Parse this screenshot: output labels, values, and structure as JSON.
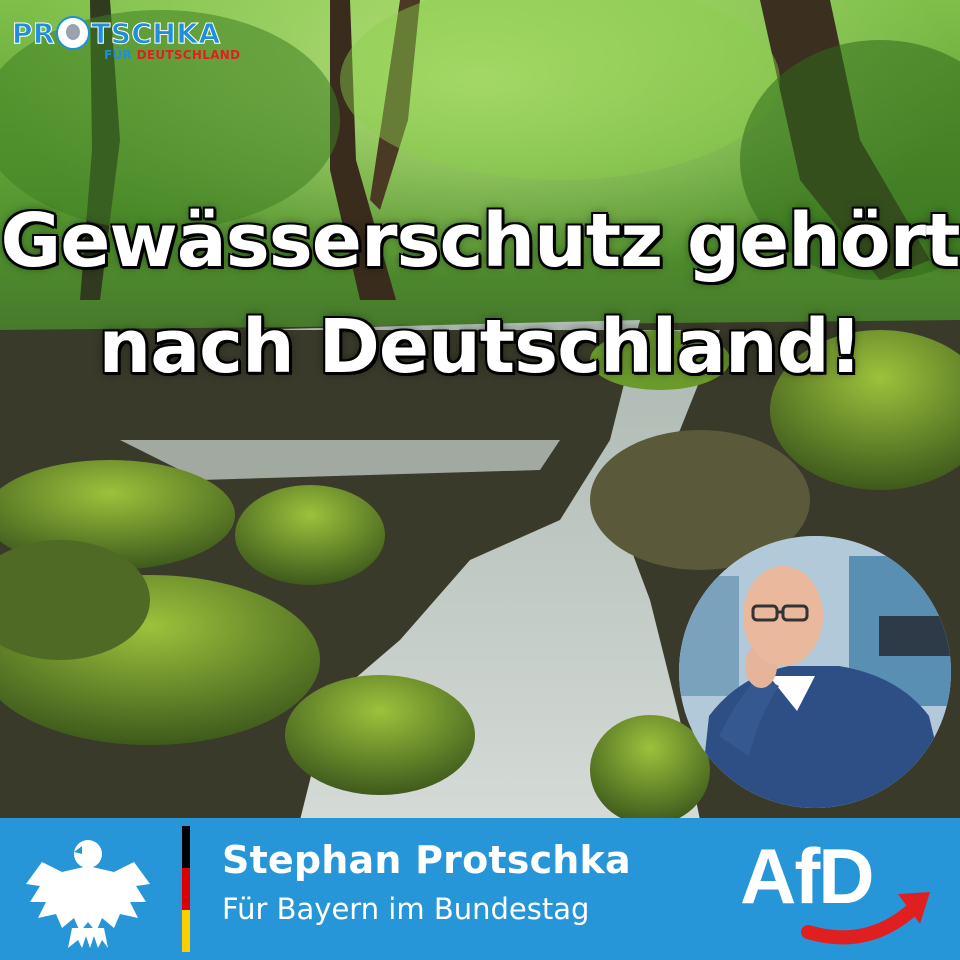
{
  "brand": {
    "logo_word": "PROTSCHKA",
    "logo_left": "PR",
    "logo_right": "TSCHKA",
    "logo_sub_fuer": "FÜR",
    "logo_sub_de": "DEUTSCHLAND"
  },
  "headline": {
    "line1": "Gewässerschutz gehört",
    "line2": "nach Deutschland!"
  },
  "footer": {
    "name": "Stephan Protschka",
    "tagline": "Für Bayern im Bundestag",
    "party": "AfD",
    "flag_colors": [
      "#000000",
      "#dd0000",
      "#ffce00"
    ]
  },
  "colors": {
    "brand_blue": "#2796d8",
    "brand_red": "#e02020",
    "headline_text": "#ffffff"
  },
  "icons": [
    "federal-eagle-icon",
    "afd-arrow-icon"
  ]
}
